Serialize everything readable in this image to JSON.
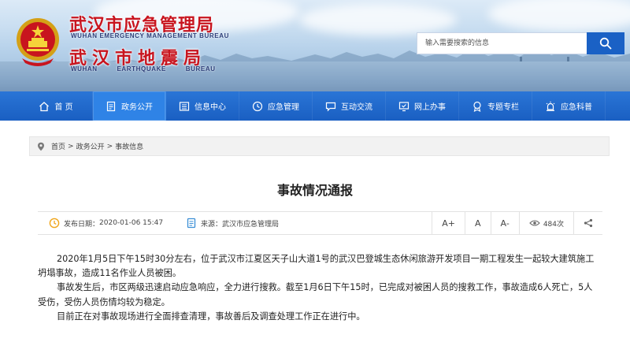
{
  "header": {
    "title_cn_1": "武汉市应急管理局",
    "title_en_1": "WUHAN EMERGENCY MANAGEMENT BUREAU",
    "title_cn_2": "武汉市地震局",
    "title_en_2": "WUHAN EARTHQUAKE BUREAU",
    "search_placeholder": "输入需要搜索的信息",
    "emblem_icon": "national-emblem-icon",
    "search_icon": "search-icon"
  },
  "nav": {
    "items": [
      {
        "label": "首 页",
        "icon": "home-icon"
      },
      {
        "label": "政务公开",
        "icon": "document-icon"
      },
      {
        "label": "信息中心",
        "icon": "info-list-icon"
      },
      {
        "label": "应急管理",
        "icon": "clock-icon"
      },
      {
        "label": "互动交流",
        "icon": "chat-icon"
      },
      {
        "label": "网上办事",
        "icon": "monitor-check-icon"
      },
      {
        "label": "专题专栏",
        "icon": "badge-icon"
      },
      {
        "label": "应急科普",
        "icon": "siren-icon"
      }
    ],
    "active_index": 1,
    "colors": {
      "bar": "#1a5fc2",
      "active": "#2f83e6"
    }
  },
  "breadcrumb": {
    "items": [
      "首页",
      "政务公开",
      "事故信息"
    ],
    "separator": ">",
    "icon": "location-pin-icon"
  },
  "article": {
    "title": "事故情况通报",
    "date_label": "发布日期：",
    "date_value": "2020-01-06 15:47",
    "source_label": "来源：",
    "source_value": "武汉市应急管理局",
    "font_tools": [
      "A+",
      "A",
      "A-"
    ],
    "views": "484次",
    "paragraphs": [
      "2020年1月5日下午15时30分左右，位于武汉市江夏区天子山大道1号的武汉巴登城生态休闲旅游开发项目一期工程发生一起较大建筑施工坍塌事故，造成11名作业人员被困。",
      "事故发生后，市区两级迅速启动应急响应，全力进行搜救。截至1月6日下午15时，已完成对被困人员的搜救工作，事故造成6人死亡，5人受伤，受伤人员伤情均较为稳定。",
      "目前正在对事故现场进行全面排查清理，事故善后及调查处理工作正在进行中。"
    ]
  }
}
